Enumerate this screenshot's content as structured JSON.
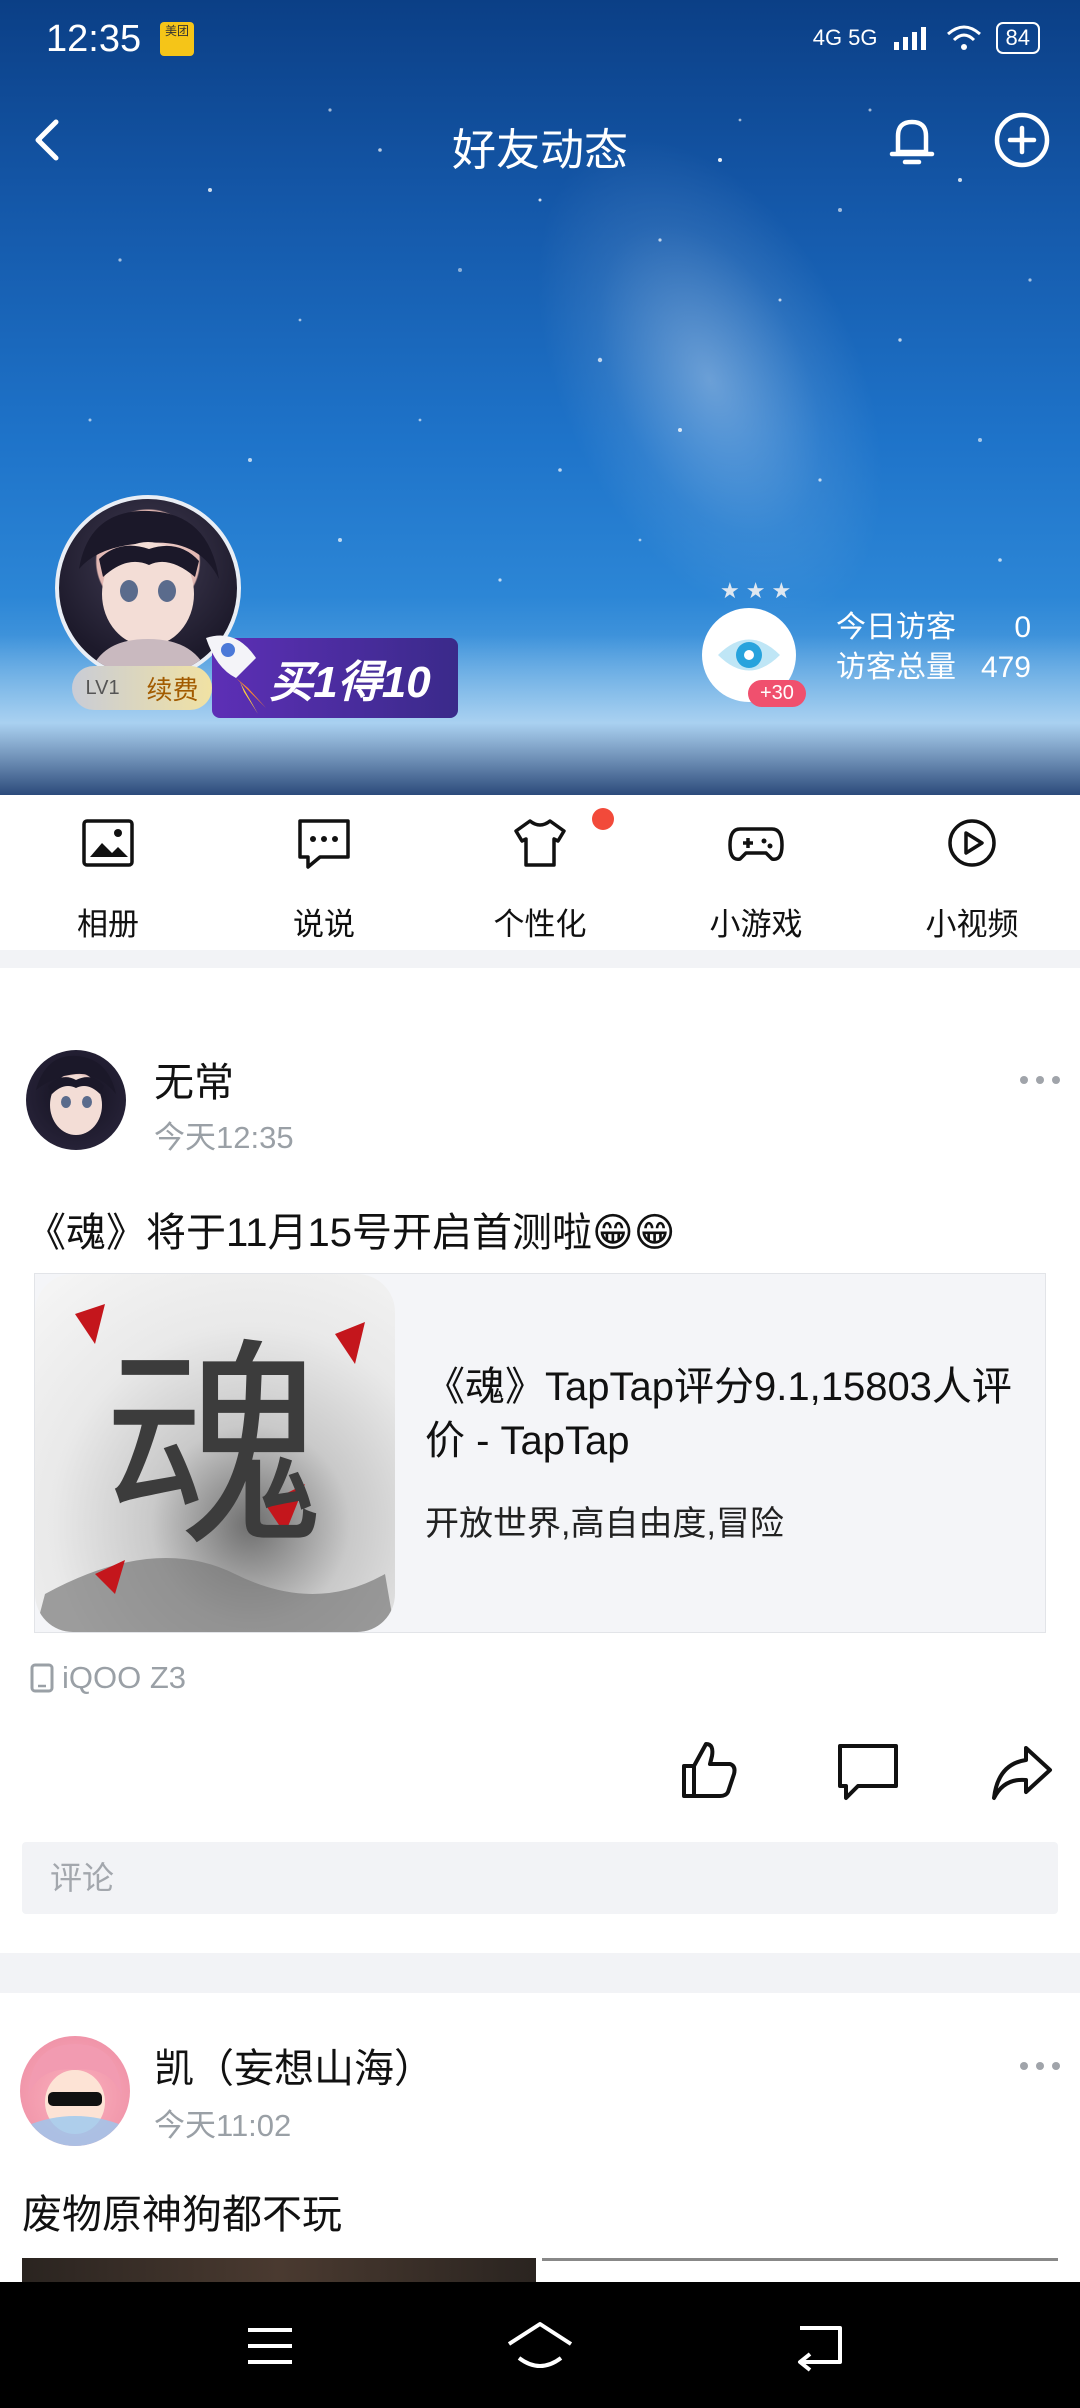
{
  "status_bar": {
    "time": "12:35",
    "app_badge": "美团",
    "signal": "4G 5G",
    "battery": "84"
  },
  "header": {
    "title": "好友动态"
  },
  "profile": {
    "level": "LV1",
    "renew_label": "续费",
    "promo_text": "买1得10",
    "eye_badge": "+30",
    "visitors_today_label": "今日访客",
    "visitors_today_value": "0",
    "visitors_total_label": "访客总量",
    "visitors_total_value": "479"
  },
  "menu": {
    "items": [
      {
        "label": "相册",
        "icon": "photo-album-icon"
      },
      {
        "label": "说说",
        "icon": "message-bubble-icon"
      },
      {
        "label": "个性化",
        "icon": "tshirt-icon"
      },
      {
        "label": "小游戏",
        "icon": "gamepad-icon"
      },
      {
        "label": "小视频",
        "icon": "play-circle-icon"
      }
    ]
  },
  "feed": {
    "posts": [
      {
        "author": "无常",
        "time": "今天12:35",
        "text": "《魂》将于11月15号开启首测啦😁😁",
        "link_card": {
          "title": "《魂》TapTap评分9.1,15803人评价 - TapTap",
          "subtitle": "开放世界,高自由度,冒险",
          "thumb_text": "魂"
        },
        "device": "iQOO Z3",
        "comment_placeholder": "评论"
      },
      {
        "author": "凯（妄想山海）",
        "time": "今天11:02",
        "text": "废物原神狗都不玩"
      }
    ]
  },
  "colors": {
    "sky_top": "#0b3f86",
    "sky_bottom": "#9fcbef",
    "badge_red": "#f24a3a",
    "promo_purple": "#5d2fb6",
    "muted_text": "#9aa0a6"
  }
}
